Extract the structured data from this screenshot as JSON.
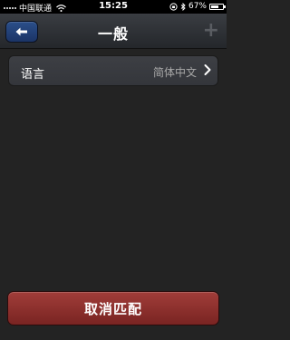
{
  "status_bar": {
    "carrier": "中国联通",
    "time": "15:25",
    "battery_percent": "67%",
    "battery_level": 0.67,
    "icons": [
      "signal-icon",
      "wifi-icon",
      "orientation-lock-icon",
      "bluetooth-icon",
      "battery-icon"
    ]
  },
  "nav": {
    "title": "一般",
    "back_icon": "back-arrow-icon",
    "add_icon": "plus-icon",
    "add_label": "+"
  },
  "settings": {
    "items": [
      {
        "label": "语言",
        "value": "简体中文"
      }
    ]
  },
  "footer": {
    "unpair_label": "取消匹配"
  },
  "colors": {
    "back_button": "#23447a",
    "unpair_button": "#8b2f2c",
    "cell_bg": "#393b40",
    "page_bg": "#232323"
  }
}
